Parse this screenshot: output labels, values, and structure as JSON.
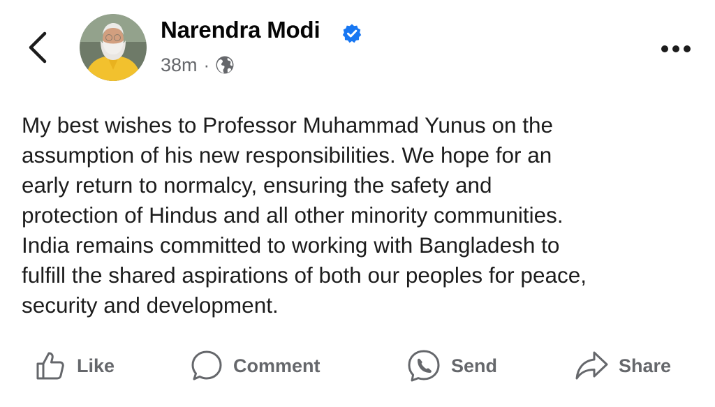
{
  "header": {
    "author_name": "Narendra Modi",
    "timestamp": "38m",
    "separator": "·",
    "icons": {
      "back": "chevron-left-icon",
      "verified": "verified-badge-icon",
      "audience": "globe-icon",
      "more": "more-options-icon"
    }
  },
  "post": {
    "text": "My best wishes to Professor Muhammad Yunus on the\nassumption of his new responsibilities. We hope for an\nearly return to normalcy, ensuring the safety and\nprotection of Hindus and all other minority communities.\nIndia remains committed to working with Bangladesh to\nfulfill the shared aspirations of both our peoples for peace,\nsecurity and development."
  },
  "actions": {
    "like_label": "Like",
    "comment_label": "Comment",
    "send_label": "Send",
    "share_label": "Share",
    "icons": [
      "thumbs-up-icon",
      "comment-bubble-icon",
      "messenger-icon",
      "share-arrow-icon"
    ]
  },
  "colors": {
    "verified_blue": "#1877f2",
    "secondary_text": "#65676b",
    "primary_text": "#050505",
    "avatar_jacket": "#f2c12e"
  }
}
